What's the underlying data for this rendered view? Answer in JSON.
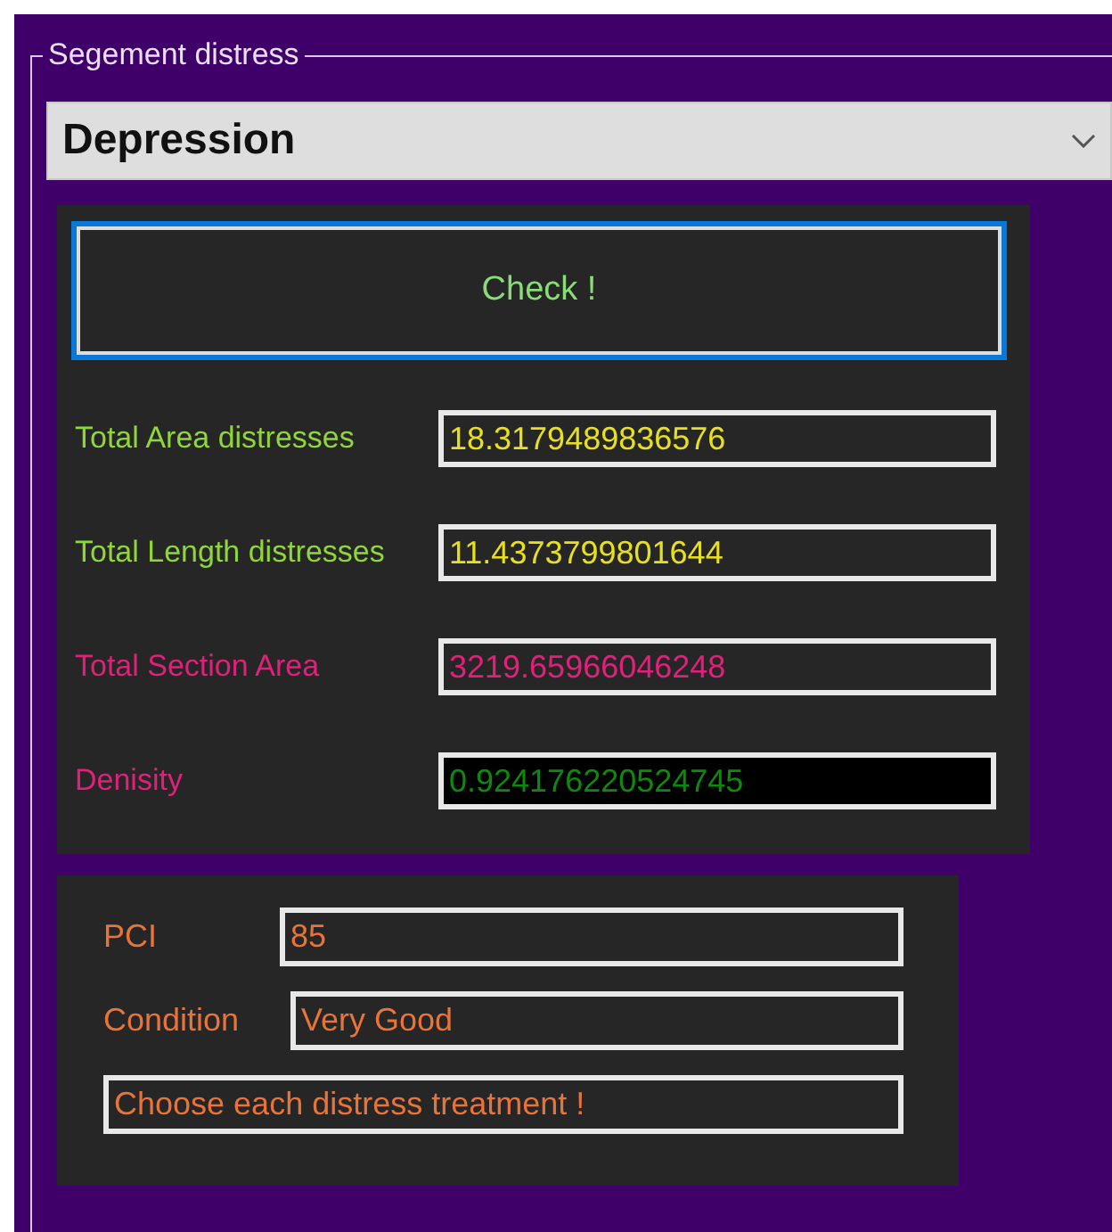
{
  "group": {
    "title": "Segement distress"
  },
  "distress_type": {
    "value": "Depression"
  },
  "check_button": {
    "label": "Check !"
  },
  "measurements": [
    {
      "label": "Total Area distresses",
      "value": "18.3179489836576",
      "kind": "distress"
    },
    {
      "label": "Total Length distresses",
      "value": "11.4373799801644",
      "kind": "distress"
    },
    {
      "label": "Total Section Area",
      "value": "3219.65966046248",
      "kind": "section"
    },
    {
      "label": "Denisity",
      "value": "0.924176220524745",
      "kind": "density"
    }
  ],
  "result": {
    "pci_label": "PCI",
    "pci": "85",
    "condition_label": "Condition",
    "condition": "Very Good",
    "message": "Choose each distress treatment !"
  }
}
